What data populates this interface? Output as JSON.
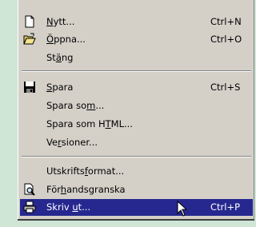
{
  "menu": {
    "items": [
      {
        "pre": "",
        "ul": "N",
        "post": "ytt...",
        "shortcut": "Ctrl+N",
        "icon": "new-document-icon"
      },
      {
        "pre": "",
        "ul": "Ö",
        "post": "ppna...",
        "shortcut": "Ctrl+O",
        "icon": "open-folder-icon"
      },
      {
        "pre": "St",
        "ul": "ä",
        "post": "ng",
        "shortcut": "",
        "icon": ""
      },
      {
        "pre": "",
        "ul": "S",
        "post": "para",
        "shortcut": "Ctrl+S",
        "icon": "save-disk-icon"
      },
      {
        "pre": "Spara so",
        "ul": "m",
        "post": "...",
        "shortcut": "",
        "icon": ""
      },
      {
        "pre": "Spara som H",
        "ul": "T",
        "post": "ML...",
        "shortcut": "",
        "icon": ""
      },
      {
        "pre": "Ve",
        "ul": "r",
        "post": "sioner...",
        "shortcut": "",
        "icon": ""
      },
      {
        "pre": "Utskrifts",
        "ul": "f",
        "post": "ormat...",
        "shortcut": "",
        "icon": ""
      },
      {
        "pre": "För",
        "ul": "h",
        "post": "andsgranska",
        "shortcut": "",
        "icon": "print-preview-icon"
      },
      {
        "pre": "Skriv ",
        "ul": "u",
        "post": "t...",
        "shortcut": "Ctrl+P",
        "icon": "printer-icon"
      }
    ]
  },
  "colors": {
    "menu_background": "#d4d0c8",
    "highlight": "#26288f",
    "page_background": "#cfe5d6"
  }
}
